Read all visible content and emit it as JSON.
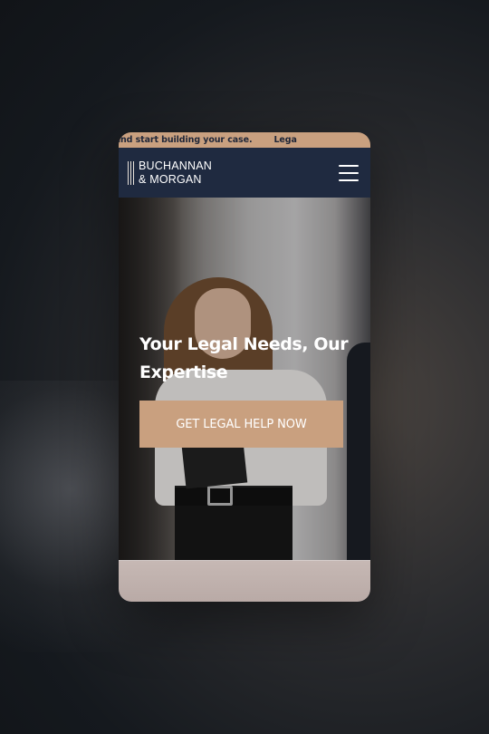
{
  "ticker": {
    "segment_1": "e a consultation and start building your case.",
    "segment_2": "Lega"
  },
  "header": {
    "logo_line_1": "BUCHANNAN",
    "logo_line_2": "& MORGAN",
    "menu_icon": "hamburger-menu-icon"
  },
  "hero": {
    "title": "Your Legal Needs, Our Expertise",
    "cta_label": "GET LEGAL HELP NOW"
  },
  "colors": {
    "accent": "#c9a07f",
    "navy": "#1f2a40",
    "text_light": "#ffffff"
  }
}
